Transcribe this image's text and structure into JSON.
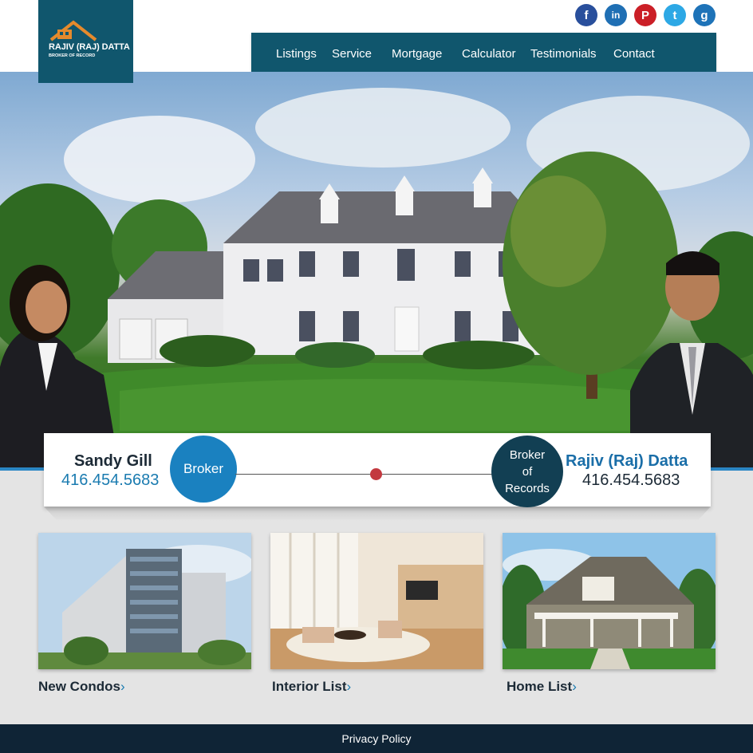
{
  "logo": {
    "title": "RAJIV (RAJ) DATTA",
    "subtitle": "BROKER OF RECORD"
  },
  "social": [
    {
      "icon": "facebook-icon",
      "glyph": "f"
    },
    {
      "icon": "linkedin-icon",
      "glyph": "in"
    },
    {
      "icon": "pinterest-icon",
      "glyph": "P"
    },
    {
      "icon": "twitter-icon",
      "glyph": "t"
    },
    {
      "icon": "github-icon",
      "glyph": "g"
    }
  ],
  "nav": {
    "items": [
      "Listings",
      "Service",
      "Mortgage",
      "Calculator",
      "Testimonials",
      "Contact"
    ]
  },
  "brokers": {
    "left": {
      "name": "Sandy Gill",
      "phone": "416.454.5683",
      "role": "Broker"
    },
    "right": {
      "name": "Rajiv (Raj) Datta",
      "phone": "416.454.5683",
      "role_lines": [
        "Broker",
        "of",
        "Records"
      ]
    }
  },
  "tiles": [
    {
      "label": "New Condos",
      "chevron": "›"
    },
    {
      "label": "Interior List",
      "chevron": "›"
    },
    {
      "label": "Home List",
      "chevron": "›"
    }
  ],
  "footer": {
    "link": "Privacy Policy"
  },
  "colors": {
    "brand_dark": "#10566d",
    "accent_blue": "#1a81c0",
    "footer_bg": "#0f2436",
    "dot_red": "#c3393f"
  }
}
